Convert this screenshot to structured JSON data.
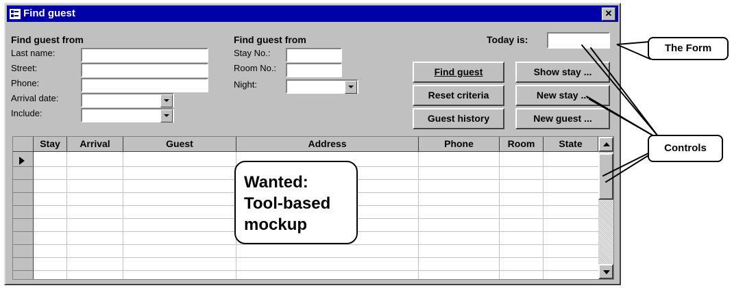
{
  "window": {
    "title": "Find guest",
    "close_glyph": "✕"
  },
  "criteria_left": {
    "header": "Find guest from",
    "last_name_label": "Last name:",
    "street_label": "Street:",
    "phone_label": "Phone:",
    "arrival_date_label": "Arrival date:",
    "include_label": "Include:",
    "last_name_value": "",
    "street_value": "",
    "phone_value": "",
    "arrival_date_value": "",
    "include_value": ""
  },
  "criteria_mid": {
    "header": "Find guest from",
    "stay_no_label": "Stay No.:",
    "room_no_label": "Room No.:",
    "night_label": "Night:",
    "stay_no_value": "",
    "room_no_value": "",
    "night_value": ""
  },
  "today": {
    "label": "Today is:",
    "value": ""
  },
  "buttons": {
    "find_guest": "Find guest",
    "show_stay": "Show stay ...",
    "reset_criteria": "Reset criteria",
    "new_stay": "New stay ...",
    "guest_history": "Guest history",
    "new_guest": "New guest ..."
  },
  "table": {
    "columns": [
      "Stay",
      "Arrival",
      "Guest",
      "Address",
      "Phone",
      "Room",
      "State"
    ],
    "rows": []
  },
  "annotations": {
    "the_form": "The Form",
    "controls": "Controls",
    "wanted_line1": "Wanted:",
    "wanted_line2": "Tool-based",
    "wanted_line3": "mockup"
  },
  "colors": {
    "titlebar": "#0000a8",
    "face": "#c0c0c0"
  },
  "icons": {
    "window_icon": "form-icon",
    "close": "close-icon",
    "dropdown": "chevron-down-icon",
    "record_pointer": "record-selector-icon"
  }
}
